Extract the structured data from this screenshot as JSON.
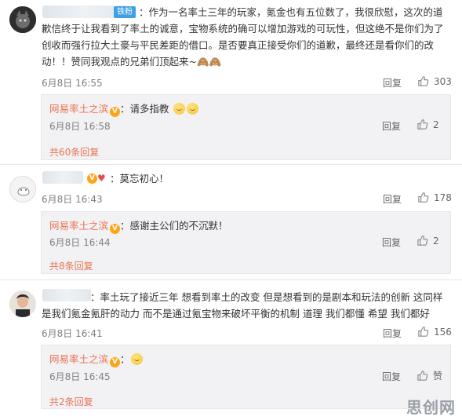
{
  "comments": [
    {
      "badge": "铁粉",
      "text": "：作为一名率土三年的玩家，氪金也有五位数了，我很欣慰，这次的道歉信终于让我看到了率土的诚意，宝物系统的确可以增加游戏的可玩性，但这绝不是你们为了创收而强行拉大土豪与平民差距的借口。是否要真正接受你们的道歉，最终还是看你们的改动！！赞同我观点的兄弟们顶起来~🙈🙈",
      "time": "6月8日 16:55",
      "reply_label": "回复",
      "likes": "303",
      "reply": {
        "name": "网易率土之滨",
        "text": "：请多指教",
        "time": "6月8日 16:58",
        "reply_label": "回复",
        "likes": "2"
      },
      "more": "共60条回复"
    },
    {
      "text": "：莫忘初心！",
      "time": "6月8日 16:43",
      "reply_label": "回复",
      "likes": "178",
      "reply": {
        "name": "网易率土之滨",
        "text": "：感谢主公们的不沉默！",
        "time": "6月8日 16:44",
        "reply_label": "回复",
        "likes": "2"
      },
      "more": "共8条回复"
    },
    {
      "text": "：率土玩了接近三年 想看到率土的改变 但是想看到的是剧本和玩法的创新 这同样是我们氪金氪肝的动力 而不是通过氪宝物来破坏平衡的机制 道理 我们都懂 希望 我们都好",
      "time": "6月8日 16:41",
      "reply_label": "回复",
      "likes": "156",
      "reply": {
        "name": "网易率土之滨",
        "text": "：",
        "time": "6月8日 16:45",
        "reply_label": "回复",
        "likes": "赞"
      },
      "more": "共2条回复"
    }
  ],
  "watermark": "思创网",
  "colors": {
    "accent": "#eb7350",
    "badge": "#3ea0e5",
    "vbadge": "#ffa417",
    "reply_bg": "#f2f2f5"
  }
}
